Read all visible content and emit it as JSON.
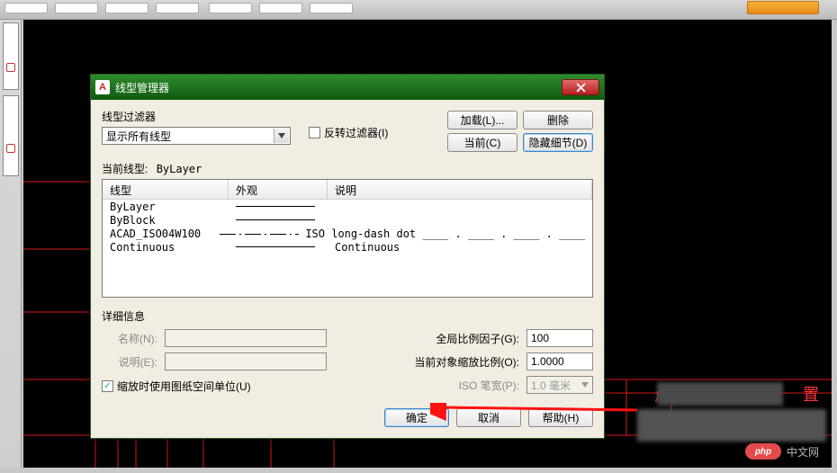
{
  "dialog": {
    "title": "线型管理器",
    "filter_label": "线型过滤器",
    "filter_selected": "显示所有线型",
    "invert_filter_label": "反转过滤器(I)",
    "invert_filter_checked": false,
    "load_btn": "加载(L)...",
    "delete_btn": "删除",
    "current_btn": "当前(C)",
    "hide_details_btn": "隐藏细节(D)",
    "current_linetype_label": "当前线型:",
    "current_linetype_value": "ByLayer",
    "columns": {
      "type": "线型",
      "look": "外观",
      "desc": "说明"
    },
    "rows": [
      {
        "name": "ByLayer",
        "look": "solid",
        "desc": ""
      },
      {
        "name": "ByBlock",
        "look": "solid",
        "desc": ""
      },
      {
        "name": "ACAD_ISO04W100",
        "look": "iso",
        "desc": "ISO long-dash dot ____ . ____ . ____ . ____"
      },
      {
        "name": "Continuous",
        "look": "solid",
        "desc": "Continuous"
      }
    ],
    "details": {
      "title": "详细信息",
      "name_label": "名称(N):",
      "desc_label": "说明(E):",
      "name_value": "",
      "desc_value": "",
      "global_scale_label": "全局比例因子(G):",
      "global_scale_value": "100",
      "obj_scale_label": "当前对象缩放比例(O):",
      "obj_scale_value": "1.0000",
      "iso_pen_label": "ISO 笔宽(P):",
      "iso_pen_value": "1.0 毫米",
      "use_paper_units_label": "缩放时使用图纸空间单位(U)",
      "use_paper_units_checked": true
    },
    "footer": {
      "ok": "确定",
      "cancel": "取消",
      "help": "帮助(H)"
    }
  },
  "annotation": {
    "prefix": "点击",
    "suffix": "置"
  },
  "watermark": {
    "badge": "php",
    "text": "中文网"
  }
}
